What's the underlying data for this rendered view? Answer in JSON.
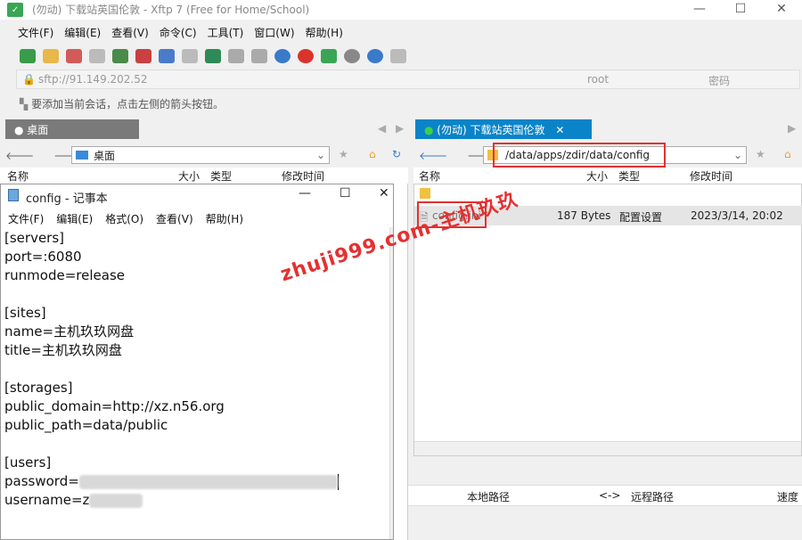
{
  "window": {
    "title": "(勿动) 下载站英国伦敦 - Xftp 7 (Free for Home/School)",
    "min": "—",
    "max": "☐"
  },
  "menu": [
    "文件(F)",
    "编辑(E)",
    "查看(V)",
    "命令(C)",
    "工具(T)",
    "窗口(W)",
    "帮助(H)"
  ],
  "address": {
    "url": "sftp://91.149.202.52",
    "user": "root",
    "password_placeholder": "密码"
  },
  "hint": "要添加当前会话，点击左侧的箭头按钮。",
  "tabs": {
    "left": "桌面",
    "right": "(勿动) 下载站英国伦敦"
  },
  "left_pane": {
    "path": "桌面",
    "columns": {
      "name": "名称",
      "size": "大小",
      "type": "类型",
      "modified": "修改时间"
    }
  },
  "right_pane": {
    "path": "/data/apps/zdir/data/config",
    "columns": {
      "name": "名称",
      "size": "大小",
      "type": "类型",
      "modified": "修改时间"
    },
    "file": {
      "name": "config.ini",
      "size": "187 Bytes",
      "type": "配置设置",
      "modified": "2023/3/14, 20:02"
    }
  },
  "transfer": {
    "local": "本地路径",
    "arrow": "<->",
    "remote": "远程路径",
    "speed": "速度"
  },
  "notepad": {
    "title": "config - 记事本",
    "menu": [
      "文件(F)",
      "编辑(E)",
      "格式(O)",
      "查看(V)",
      "帮助(H)"
    ],
    "lines": {
      "l1": "[servers]",
      "l2": "port=:6080",
      "l3": "runmode=release",
      "l4": "[sites]",
      "l5": "name=主机玖玖网盘",
      "l6": "title=主机玖玖网盘",
      "l7": "[storages]",
      "l8": "public_domain=http://xz.n56.org",
      "l9": "public_path=data/public",
      "l10": "[users]",
      "l11_prefix": "password=",
      "l12_prefix": "username=z"
    }
  },
  "watermark": "zhuji999.com-主机玖玖",
  "colors": {
    "accent": "#0078d7",
    "tab_active": "#0a84c8",
    "tab_inactive": "#7a7a7a",
    "annotation": "#e53030"
  }
}
